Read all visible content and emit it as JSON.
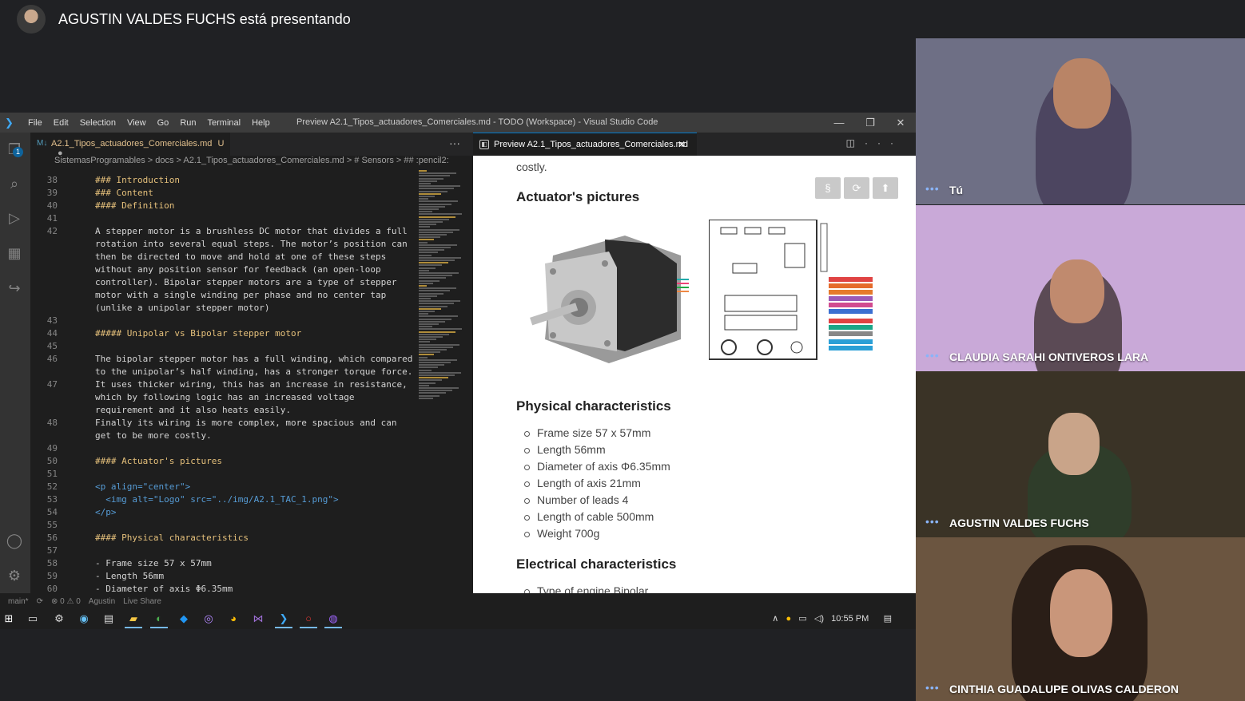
{
  "meet": {
    "presenter_text": "AGUSTIN VALDES FUCHS está presentando"
  },
  "vscode": {
    "menu": [
      "File",
      "Edit",
      "Selection",
      "View",
      "Go",
      "Run",
      "Terminal",
      "Help"
    ],
    "window_title": "Preview A2.1_Tipos_actuadores_Comerciales.md - TODO (Workspace) - Visual Studio Code",
    "window_controls": {
      "minimize": "—",
      "restore": "❐",
      "close": "✕"
    },
    "activity_badge": "1",
    "editor_tab": {
      "label": "A2.1_Tipos_actuadores_Comerciales.md",
      "status": "U",
      "dot": "●"
    },
    "breadcrumb": "SistemasProgramables  >  docs  >  A2.1_Tipos_actuadores_Comerciales.md  >  # Sensors  >  ## :pencil2:",
    "code_lines": [
      {
        "n": "38",
        "t": "### Introduction",
        "k": "h"
      },
      {
        "n": "39",
        "t": "### Content",
        "k": "h"
      },
      {
        "n": "40",
        "t": "#### Definition",
        "k": "h"
      },
      {
        "n": "41",
        "t": "",
        "k": ""
      },
      {
        "n": "42",
        "t": "A stepper motor is a brushless DC motor that divides a full",
        "k": ""
      },
      {
        "n": "",
        "t": "rotation into several equal steps. The motor’s position can",
        "k": ""
      },
      {
        "n": "",
        "t": "then be directed to move and hold at one of these steps",
        "k": ""
      },
      {
        "n": "",
        "t": "without any position sensor for feedback (an open-loop",
        "k": ""
      },
      {
        "n": "",
        "t": "controller). Bipolar stepper motors are a type of stepper",
        "k": ""
      },
      {
        "n": "",
        "t": "motor with a single winding per phase and no center tap",
        "k": ""
      },
      {
        "n": "",
        "t": "(unlike a unipolar stepper motor)",
        "k": ""
      },
      {
        "n": "43",
        "t": "",
        "k": ""
      },
      {
        "n": "44",
        "t": "##### Unipolar vs Bipolar stepper motor",
        "k": "h"
      },
      {
        "n": "45",
        "t": "",
        "k": ""
      },
      {
        "n": "46",
        "t": "The bipolar stepper motor has a full winding, which compared",
        "k": ""
      },
      {
        "n": "",
        "t": "to the unipolar’s half winding, has a stronger torque force.",
        "k": ""
      },
      {
        "n": "47",
        "t": "It uses thicker wiring, this has an increase in resistance,",
        "k": ""
      },
      {
        "n": "",
        "t": "which by following logic has an increased voltage",
        "k": ""
      },
      {
        "n": "",
        "t": "requirement and it also heats easily.",
        "k": ""
      },
      {
        "n": "48",
        "t": "Finally its wiring is more complex, more spacious and can",
        "k": ""
      },
      {
        "n": "",
        "t": "get to be more costly.",
        "k": ""
      },
      {
        "n": "49",
        "t": "",
        "k": ""
      },
      {
        "n": "50",
        "t": "#### Actuator's pictures",
        "k": "h"
      },
      {
        "n": "51",
        "t": "",
        "k": ""
      },
      {
        "n": "52",
        "t": "<p align=\"center\">",
        "k": "tag"
      },
      {
        "n": "53",
        "t": "  <img alt=\"Logo\" src=\"../img/A2.1_TAC_1.png\">",
        "k": "tag"
      },
      {
        "n": "54",
        "t": "</p>",
        "k": "tag"
      },
      {
        "n": "55",
        "t": "",
        "k": ""
      },
      {
        "n": "56",
        "t": "#### Physical characteristics",
        "k": "h"
      },
      {
        "n": "57",
        "t": "",
        "k": ""
      },
      {
        "n": "58",
        "t": "- Frame size 57 x 57mm",
        "k": ""
      },
      {
        "n": "59",
        "t": "- Length 56mm",
        "k": ""
      },
      {
        "n": "60",
        "t": "- Diameter of axis Φ6.35mm",
        "k": ""
      }
    ],
    "preview_tab": "Preview A2.1_Tipos_actuadores_Comerciales.md",
    "preview": {
      "costly": "costly.",
      "h_pictures": "Actuator's pictures",
      "buttons": [
        "§",
        "⟳",
        "⬆"
      ],
      "h_physical": "Physical characteristics",
      "physical": [
        "Frame size 57 x 57mm",
        "Length 56mm",
        "Diameter of axis Φ6.35mm",
        "Length of axis 21mm",
        "Number of leads 4",
        "Length of cable 500mm",
        "Weight 700g"
      ],
      "h_electrical": "Electrical characteristics",
      "electrical_first": "Type of engine Bipolar"
    },
    "status": {
      "branch": "main*",
      "errors": "⊗ 0 ⚠ 0",
      "user": "Agustin",
      "liveshare": "Live Share"
    },
    "clock": "10:55 PM"
  },
  "participants": [
    {
      "name": "Tú",
      "bg": "#6e6f85"
    },
    {
      "name": "CLAUDIA SARAHI ONTIVEROS LARA",
      "bg": "#c9a9d8"
    },
    {
      "name": "AGUSTIN VALDES FUCHS",
      "bg": "#3a3326"
    },
    {
      "name": "CINTHIA GUADALUPE OLIVAS CALDERON",
      "bg": "#6b5540"
    }
  ]
}
